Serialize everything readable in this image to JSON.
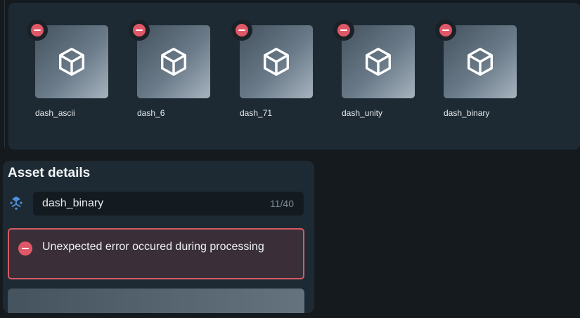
{
  "assets": [
    {
      "name": "dash_ascii"
    },
    {
      "name": "dash_6"
    },
    {
      "name": "dash_71"
    },
    {
      "name": "dash_unity"
    },
    {
      "name": "dash_binary"
    }
  ],
  "details": {
    "title": "Asset details",
    "name_value": "dash_binary",
    "char_count": "11/40",
    "error_message": "Unexpected error occured during processing"
  },
  "colors": {
    "panel": "#1e2a33",
    "error_red": "#e05868",
    "error_border": "#d65a63",
    "type_icon_blue": "#4a90d9"
  },
  "icons": {
    "asset_thumb": "cube-icon",
    "remove": "remove-circle-icon",
    "asset_type": "model-icon",
    "error": "error-circle-icon"
  }
}
